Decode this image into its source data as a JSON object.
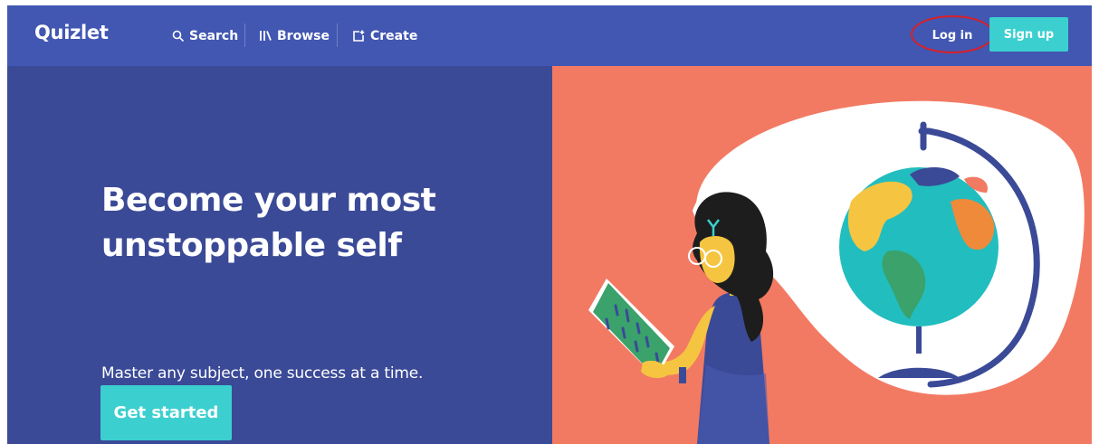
{
  "nav": {
    "logo": "Quizlet",
    "search_label": "Search",
    "browse_label": "Browse",
    "create_label": "Create",
    "login_label": "Log in",
    "signup_label": "Sign up",
    "icons": {
      "search": "search-icon",
      "browse": "library-books-icon",
      "create": "create-set-icon"
    }
  },
  "hero": {
    "headline": "Become your most unstoppable self",
    "subline": "Master any subject, one success at a time.",
    "cta_label": "Get started",
    "illustration": "student-reading-with-globe-illustration"
  },
  "annotation": {
    "highlight": "red-ellipse-around-log-in"
  },
  "colors": {
    "nav_bg": "#4257b2",
    "hero_left_bg": "#3b4a97",
    "hero_right_bg": "#f27a62",
    "accent_teal": "#3ccfcf",
    "annotation_red": "#d91f26"
  }
}
